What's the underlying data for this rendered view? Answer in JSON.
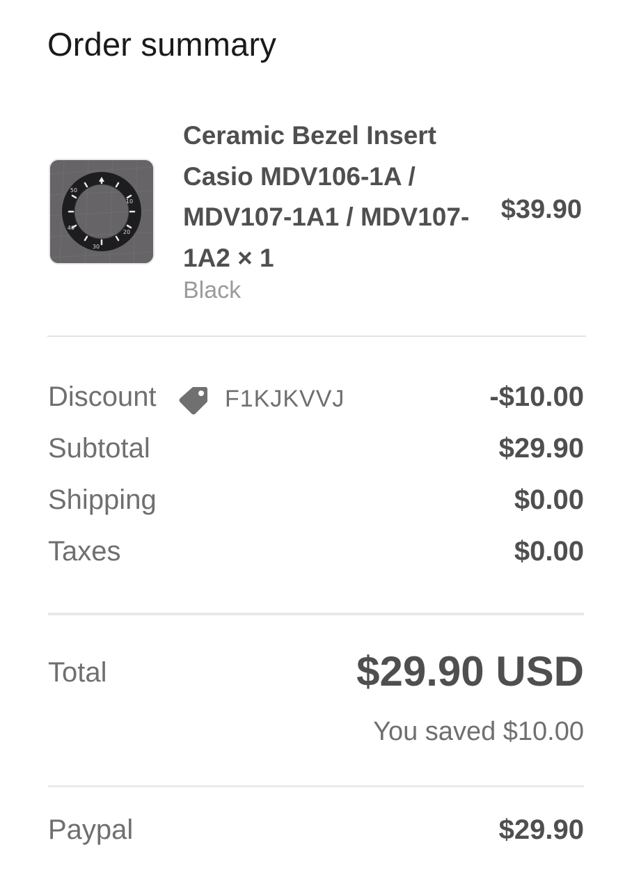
{
  "header": {
    "title": "Order summary"
  },
  "item": {
    "image_icon": "bezel-insert-product-photo",
    "name": "Ceramic Bezel Insert Casio MDV106-1A / MDV107-1A1 / MDV107-1A2 × 1",
    "variant": "Black",
    "price": "$39.90",
    "bezel_numbers": [
      "10",
      "20",
      "30",
      "40",
      "50"
    ]
  },
  "summary": {
    "discount": {
      "label": "Discount",
      "icon": "tag-icon",
      "code": "F1KJKVVJ",
      "value": "-$10.00"
    },
    "subtotal": {
      "label": "Subtotal",
      "value": "$29.90"
    },
    "shipping": {
      "label": "Shipping",
      "value": "$0.00"
    },
    "taxes": {
      "label": "Taxes",
      "value": "$0.00"
    }
  },
  "total": {
    "label": "Total",
    "value": "$29.90 USD",
    "saved": "You saved $10.00"
  },
  "payment": {
    "label": "Paypal",
    "value": "$29.90"
  },
  "colors": {
    "title": "#1a1a1a",
    "text_bold": "#4f4f4f",
    "text_muted": "#6f6f6f",
    "variant": "#9b9b9b",
    "divider": "#e4e4e4"
  }
}
